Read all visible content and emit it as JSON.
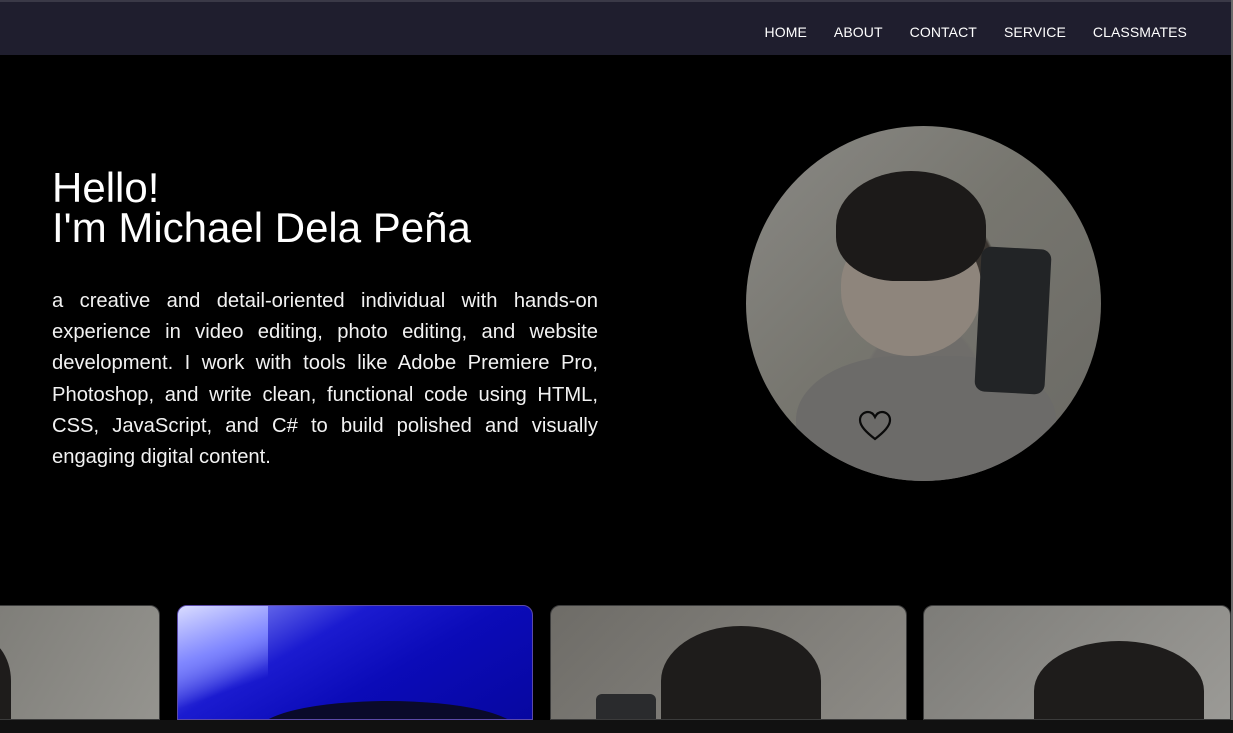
{
  "nav": {
    "links": [
      "HOME",
      "ABOUT",
      "CONTACT",
      "SERVICE",
      "CLASSMATES"
    ]
  },
  "hero": {
    "greeting": "Hello!",
    "name_line": "I'm Michael Dela Peña",
    "description": "a creative and detail-oriented individual with hands-on experience in video editing, photo editing, and website development. I work with tools like Adobe Premiere Pro, Photoshop, and write clean, functional code using HTML, CSS, JavaScript, and C# to build polished and visually engaging digital content."
  },
  "icons": {
    "like": "heart-icon"
  },
  "colors": {
    "background": "#000000",
    "navbar": "#1f1e2e",
    "text": "#ffffff"
  }
}
